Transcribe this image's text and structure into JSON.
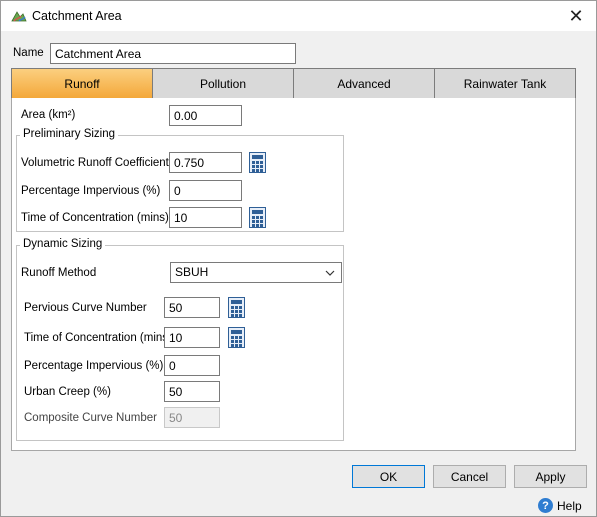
{
  "window": {
    "title": "Catchment Area",
    "close_glyph": "✕"
  },
  "name": {
    "label": "Name",
    "value": "Catchment Area"
  },
  "tabs": [
    {
      "label": "Runoff",
      "active": true
    },
    {
      "label": "Pollution",
      "active": false
    },
    {
      "label": "Advanced",
      "active": false
    },
    {
      "label": "Rainwater Tank",
      "active": false
    }
  ],
  "runoff": {
    "area": {
      "label": "Area (km²)",
      "value": "0.00"
    },
    "preliminary": {
      "title": "Preliminary Sizing",
      "volumetric_runoff": {
        "label": "Volumetric Runoff Coefficient",
        "value": "0.750"
      },
      "percentage_impervious": {
        "label": "Percentage Impervious (%)",
        "value": "0"
      },
      "time_of_concentration": {
        "label": "Time of Concentration (mins)",
        "value": "10"
      }
    },
    "dynamic": {
      "title": "Dynamic Sizing",
      "runoff_method": {
        "label": "Runoff Method",
        "value": "SBUH"
      },
      "pervious_curve_number": {
        "label": "Pervious Curve Number",
        "value": "50"
      },
      "time_of_concentration": {
        "label": "Time of Concentration (mins)",
        "value": "10"
      },
      "percentage_impervious": {
        "label": "Percentage Impervious (%)",
        "value": "0"
      },
      "urban_creep": {
        "label": "Urban Creep (%)",
        "value": "50"
      },
      "composite_curve_number": {
        "label": "Composite Curve Number",
        "value": "50"
      }
    }
  },
  "buttons": {
    "ok": "OK",
    "cancel": "Cancel",
    "apply": "Apply",
    "help": "Help",
    "help_glyph": "?"
  },
  "colors": {
    "active_tab_top": "#fbcf7f",
    "active_tab_bottom": "#f4a83a",
    "calc_blue": "#2f5f96",
    "help_blue": "#2f7dd1"
  },
  "icons": {
    "app": "catchment-app-icon",
    "calculator": "calculator-icon",
    "dropdown": "chevron-down-icon",
    "help": "help-icon"
  }
}
